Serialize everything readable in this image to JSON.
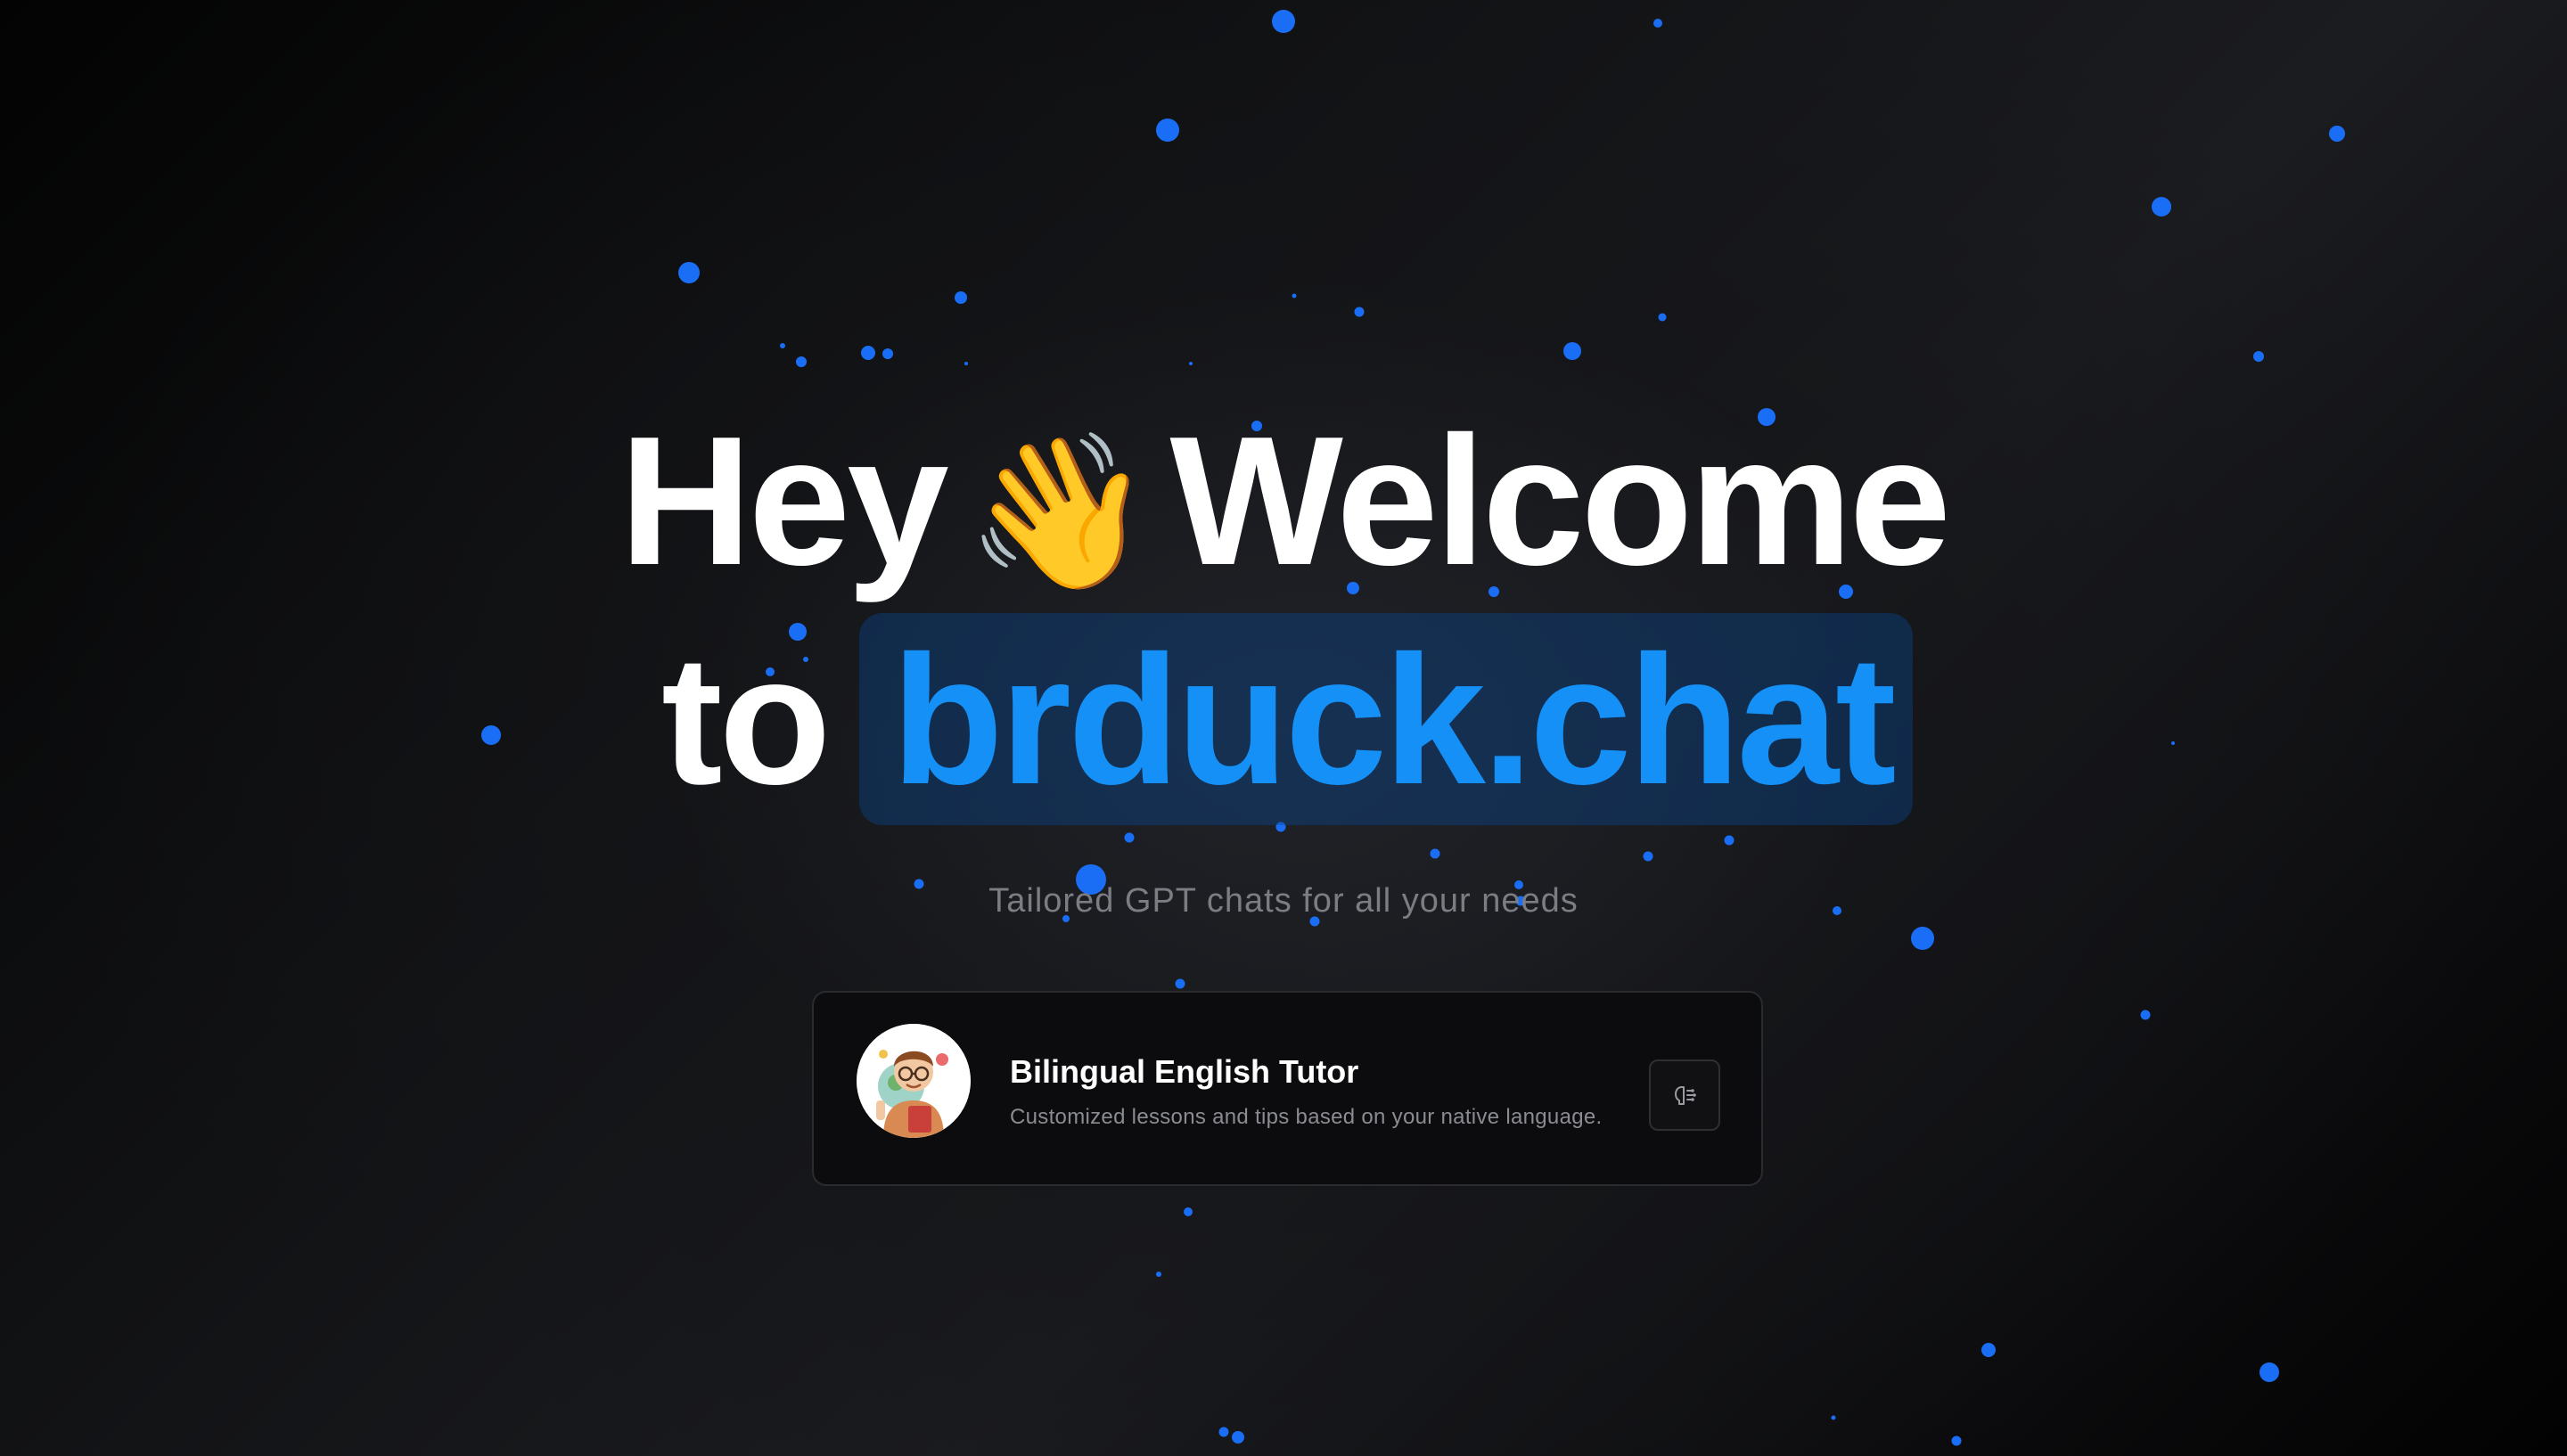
{
  "hero": {
    "line1_start": "Hey",
    "wave_emoji": "👋",
    "line1_end": "Welcome",
    "line2_start": "to",
    "brand": "brduck.chat"
  },
  "subtitle": "Tailored GPT chats for all your needs",
  "card": {
    "title": "Bilingual English Tutor",
    "description": "Customized lessons and tips based on your native language.",
    "avatar_icon": "tutor-avatar",
    "action_icon": "open-chat-icon"
  },
  "colors": {
    "background": "#111214",
    "particle": "#1a6ef5",
    "brand_text": "#1590f7",
    "brand_highlight": "#0a468c"
  }
}
